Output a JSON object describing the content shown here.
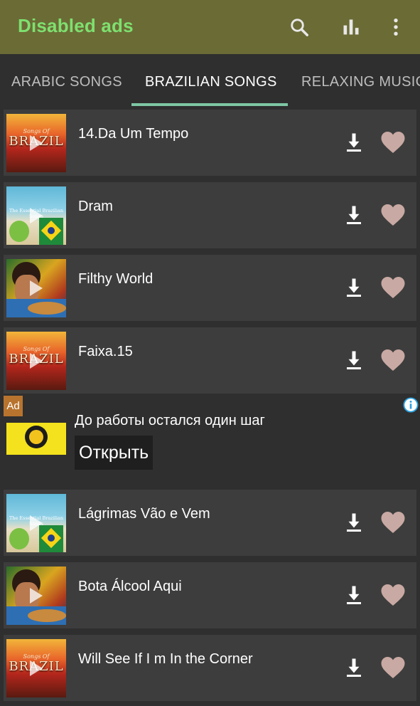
{
  "appbar": {
    "title": "Disabled ads",
    "actions": [
      "search-icon",
      "equalizer-icon",
      "more-vertical-icon"
    ]
  },
  "tabs": [
    {
      "label": "ARABIC SONGS",
      "active": false
    },
    {
      "label": "BRAZILIAN SONGS",
      "active": true
    },
    {
      "label": "RELAXING MUSIC",
      "active": false
    }
  ],
  "songs": [
    {
      "title": "14.Da Um Tempo",
      "cover": "songs-of-brazil"
    },
    {
      "title": "Dram",
      "cover": "essential-brazilian-songs"
    },
    {
      "title": "Filthy World",
      "cover": "guitarist-portrait"
    },
    {
      "title": "Faixa.15",
      "cover": "songs-of-brazil"
    },
    {
      "title": "Lágrimas Vão e Vem",
      "cover": "essential-brazilian-songs"
    },
    {
      "title": "Bota Álcool Aqui",
      "cover": "guitarist-portrait"
    },
    {
      "title": "Will See If I m In the Corner",
      "cover": "songs-of-brazil"
    }
  ],
  "covers": {
    "brazil_top": "Songs Of",
    "brazil_main": "BRAZIL",
    "essential": "The Essential Brazilian Songs"
  },
  "ad": {
    "badge": "Ad",
    "headline": "До работы остался один шаг",
    "cta": "Открыть"
  },
  "colors": {
    "appbar": "#6b6b36",
    "title": "#7ee06f",
    "tab_indicator": "#7ec6a4",
    "row_bg": "#3d3d3d",
    "heart": "#c9a9a3",
    "ad_badge": "#b8742e"
  }
}
